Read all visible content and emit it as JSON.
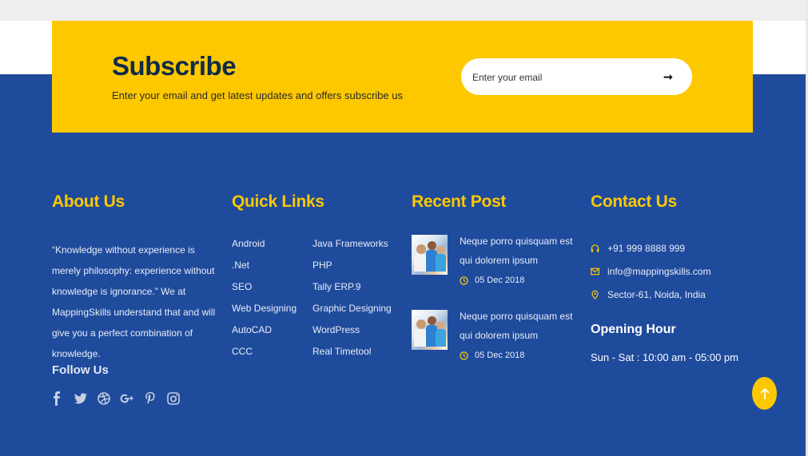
{
  "subscribe": {
    "title": "Subscribe",
    "description": "Enter your email and get latest updates and offers subscribe us",
    "email_placeholder": "Enter your email",
    "submit_glyph": "➞"
  },
  "about": {
    "title": "About Us",
    "text": "“Knowledge without experience is merely philosophy: experience without knowledge is ignorance.” We at MappingSkills understand that and will give you a perfect combination of knowledge.",
    "follow_title": "Follow Us",
    "social_icons": [
      "facebook-icon",
      "twitter-icon",
      "dribbble-icon",
      "google-plus-icon",
      "pinterest-icon",
      "instagram-icon"
    ]
  },
  "quick_links": {
    "title": "Quick Links",
    "left": [
      "Android",
      ".Net",
      "SEO",
      "Web Designing",
      "AutoCAD",
      "CCC"
    ],
    "right": [
      "Java Frameworks",
      "PHP",
      "Tally ERP.9",
      "Graphic Designing",
      "WordPress",
      "Real Timetool"
    ]
  },
  "recent_posts": {
    "title": "Recent Post",
    "posts": [
      {
        "title": "Neque porro quisquam est qui dolorem ipsum",
        "date": "05 Dec 2018"
      },
      {
        "title": "Neque porro quisquam est qui dolorem ipsum",
        "date": "05 Dec 2018"
      }
    ]
  },
  "contact": {
    "title": "Contact Us",
    "phone": "+91 999 8888 999",
    "email": "info@mappingskills.com",
    "address": "Sector-61, Noida, India",
    "opening_title": "Opening Hour",
    "opening_hours": "Sun - Sat : 10:00 am - 05:00 pm"
  },
  "colors": {
    "accent": "#fdc800",
    "footer_bg": "#1f4b9c",
    "title_dark": "#0f2a4a"
  }
}
